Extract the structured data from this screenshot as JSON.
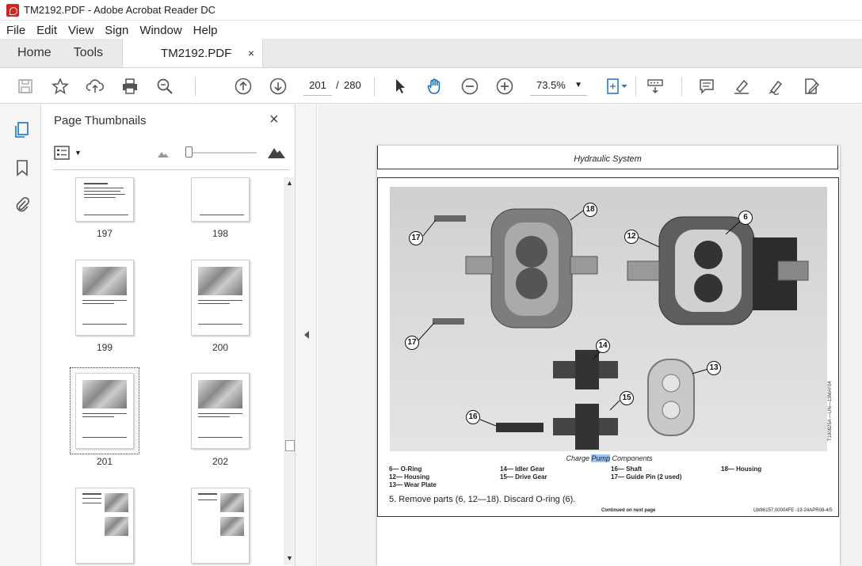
{
  "window": {
    "title": "TM2192.PDF - Adobe Acrobat Reader DC"
  },
  "menu": [
    "File",
    "Edit",
    "View",
    "Sign",
    "Window",
    "Help"
  ],
  "tabs": {
    "home": "Home",
    "tools": "Tools",
    "document": "TM2192.PDF",
    "close": "×"
  },
  "toolbar": {
    "page_current": "201",
    "page_separator": "/",
    "page_total": "280",
    "zoom": "73.5%"
  },
  "panel": {
    "title": "Page Thumbnails",
    "close": "×",
    "thumbnails": [
      {
        "label": "197"
      },
      {
        "label": "198"
      },
      {
        "label": "199"
      },
      {
        "label": "200"
      },
      {
        "label": "201",
        "selected": true
      },
      {
        "label": "202"
      },
      {
        "label": ""
      },
      {
        "label": ""
      }
    ]
  },
  "page": {
    "header": "Hydraulic System",
    "callouts": [
      "18",
      "6",
      "12",
      "17",
      "17",
      "14",
      "13",
      "15",
      "16"
    ],
    "side_code": "T190825A —UN—13MAY04",
    "caption_before": "Charge ",
    "caption_highlight": "Pump",
    "caption_after": " Components",
    "legend": [
      [
        "6— O-Ring",
        "12— Housing",
        "13— Wear Plate"
      ],
      [
        "14— Idler Gear",
        "15— Drive Gear"
      ],
      [
        "16— Shaft",
        "17— Guide Pin (2 used)"
      ],
      [
        "18— Housing"
      ]
    ],
    "step": "5.   Remove parts (6, 12—18). Discard O-ring (6).",
    "continued": "Continued on next page",
    "docref": "LW86157,00004FE -19-24APR08-4/5"
  },
  "colors": {
    "accent": "#1a73c8",
    "highlight": "#9cc4ef",
    "adobe_red": "#d7231e"
  }
}
